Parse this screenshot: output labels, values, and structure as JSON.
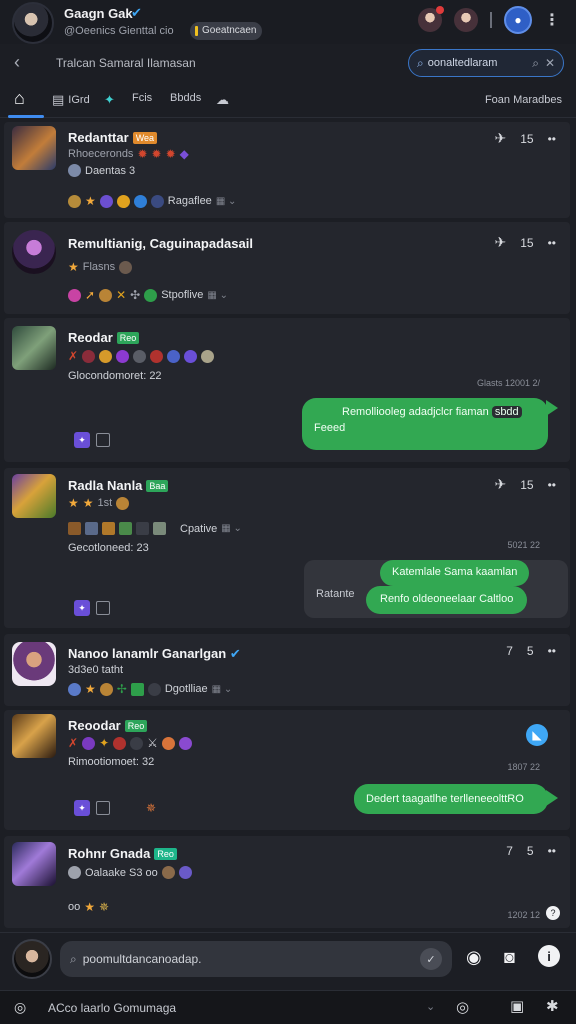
{
  "header": {
    "name": "Gaagn Gak",
    "verified_icon": "verified-badge-icon",
    "subtitle": "@Oeenics Gienttal cio",
    "pill_label": "Goeatncaen",
    "icons": [
      "notification-avatar",
      "friend-avatar",
      "profile-ring"
    ],
    "menu_icon": "more-vertical-icon"
  },
  "search": {
    "breadcrumb": "Tralcan Samaral Ilamasan",
    "query": "oonaltedlaram",
    "colors": {
      "accent": "#3a76c8"
    }
  },
  "tabs": {
    "items": [
      {
        "label": "",
        "icon": "home-icon"
      },
      {
        "label": "IGrd",
        "icon": "grid-icon"
      },
      {
        "label": "",
        "icon": "pin-icon"
      },
      {
        "label": "Fcis",
        "icon": ""
      },
      {
        "label": "Bbdds",
        "icon": ""
      },
      {
        "label": "",
        "icon": "cloud-icon"
      }
    ],
    "right_label": "Foan  Maradbes"
  },
  "feed": [
    {
      "name": "Redanttar",
      "tag": "Wea",
      "sub": "Rhoeceronds",
      "line2": "Daentas  3",
      "line3": "Ragaflee",
      "count": "15"
    },
    {
      "name": "Remultianig, Caguinapadasail",
      "sub": "Flasns",
      "line3": "Stpoflive",
      "count": "15"
    },
    {
      "name": "Reodar",
      "tag": "Reo",
      "line2": "Glocondomoret:  22",
      "timestamp": "Glasts  12001 2/",
      "bubble": "Remolliooleg adadjclcr fiaman",
      "bubble_code": "sbdd",
      "bubble_line2": "Feeed"
    },
    {
      "name": "Radla Nanla",
      "tag": "Baa",
      "sub": "1st",
      "line3": "Cpative",
      "line2": "Gecotloneed:  23",
      "count": "15",
      "timestamp": "5021 22",
      "bubble_top": "Katemlale Sama kaamlan",
      "bubble_bottom": "Renfo oldeoneelaar Caltloo",
      "grey_label": "Ratante"
    },
    {
      "name": "Nanoo lanamlr Ganarlgan",
      "sub": "3d3e0  tatht",
      "line3": "Dgotlliae",
      "count": "5",
      "prefix": "7"
    },
    {
      "name": "Reoodar",
      "tag": "Reo",
      "line2": "Rimootiomoet:  32",
      "timestamp": "1807 22",
      "bubble": "Dedert taagatlhe terlleneeolttRO"
    },
    {
      "name": "Rohnr Gnada",
      "tag": "Reo",
      "sub": "Oalaake  S3 oo",
      "line2": "oo",
      "count": "5",
      "prefix": "7",
      "timestamp": "1202 12"
    }
  ],
  "composer": {
    "placeholder": "poomultdancanoadap.",
    "icons": [
      "search-icon",
      "mic-icon",
      "camera-icon",
      "gallery-icon",
      "info-icon"
    ]
  },
  "bottom_bar": {
    "label": "ACco laarlo  Gomumaga"
  }
}
